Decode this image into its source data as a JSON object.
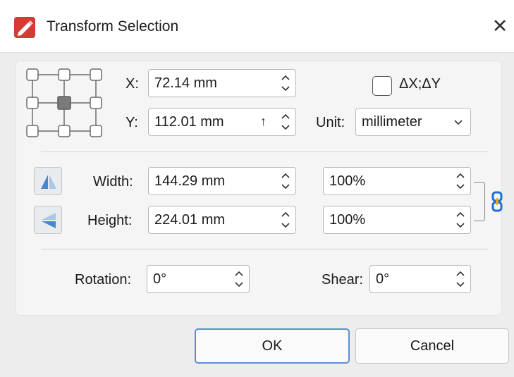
{
  "window": {
    "title": "Transform Selection",
    "close_glyph": "✕"
  },
  "position": {
    "x_label": "X:",
    "x_value": "72.14 mm",
    "y_label": "Y:",
    "y_value": "112.01 mm",
    "y_indicator": "↑",
    "delta_label": "ΔX;ΔY",
    "delta_checked": false,
    "unit_label": "Unit:",
    "unit_value": "millimeter",
    "anchor_selected": "center"
  },
  "size": {
    "width_label": "Width:",
    "width_value": "144.29 mm",
    "width_percent": "100%",
    "height_label": "Height:",
    "height_value": "224.01 mm",
    "height_percent": "100%"
  },
  "rotation": {
    "rotation_label": "Rotation:",
    "rotation_value": "0°",
    "shear_label": "Shear:",
    "shear_value": "0°"
  },
  "buttons": {
    "ok": "OK",
    "cancel": "Cancel"
  },
  "icons": {
    "app": "pdf-editor-app-icon",
    "flip_horizontal": "flip-horizontal-icon",
    "flip_vertical": "flip-vertical-icon",
    "link": "chain-link-icon"
  },
  "colors": {
    "accent": "#5b8fcf",
    "link_icon": "#1f6fd6",
    "app_icon": "#d43b35"
  }
}
